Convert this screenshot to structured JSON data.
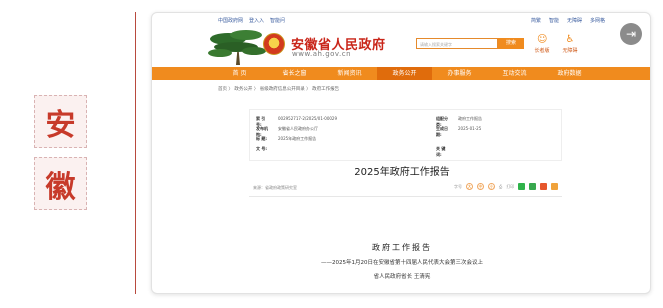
{
  "seal": {
    "char1": "安",
    "char2": "徽"
  },
  "top_links_left": [
    "中国政府网",
    "登入入",
    "智能问"
  ],
  "top_links_right": [
    "简繁",
    "智能",
    "无障碍",
    "多网格"
  ],
  "header": {
    "site_title": "安徽省人民政府",
    "site_url": "www.ah.gov.cn",
    "search_placeholder": "请输入搜索关键字",
    "search_button": "搜索",
    "quick": [
      {
        "label": "长者版",
        "icon": "elder-icon"
      },
      {
        "label": "无障碍",
        "icon": "accessibility-icon"
      }
    ]
  },
  "nav": {
    "items": [
      "首 页",
      "省长之窗",
      "新闻资讯",
      "政务公开",
      "办事服务",
      "互动交流",
      "政府数据"
    ],
    "active_index": 3
  },
  "breadcrumb": "首页 〉 政务公开 〉 省级政府信息公开目录 〉 政府工作报告",
  "info": {
    "left": [
      {
        "k": "索 引 号:",
        "v": "002952717-2/2025/01-00029"
      },
      {
        "k": "发布机构:",
        "v": "安徽省人民政府办公厅"
      },
      {
        "k": "标 题:",
        "v": "2025年政府工作报告"
      },
      {
        "k": "文 号:",
        "v": ""
      }
    ],
    "right": [
      {
        "k": "组配分类:",
        "v": "政府工作报告"
      },
      {
        "k": "生成日期:",
        "v": "2025-01-25"
      },
      {
        "k": "关 键 词:",
        "v": ""
      }
    ]
  },
  "doc_title": "2025年政府工作报告",
  "source": "来源：省政府政策研究室",
  "tools": {
    "font_label": "字号",
    "sizes": [
      "大",
      "中",
      "小"
    ],
    "print_label": "打印"
  },
  "body": {
    "title": "政府工作报告",
    "subtitle": "——2025年1月20日在安徽省第十四届人民代表大会第三次会议上",
    "sign": "省人民政府省长 王清宪"
  },
  "colors": {
    "accent": "#f08b1e",
    "title_red": "#c92519",
    "divider": "#b84a3e"
  }
}
